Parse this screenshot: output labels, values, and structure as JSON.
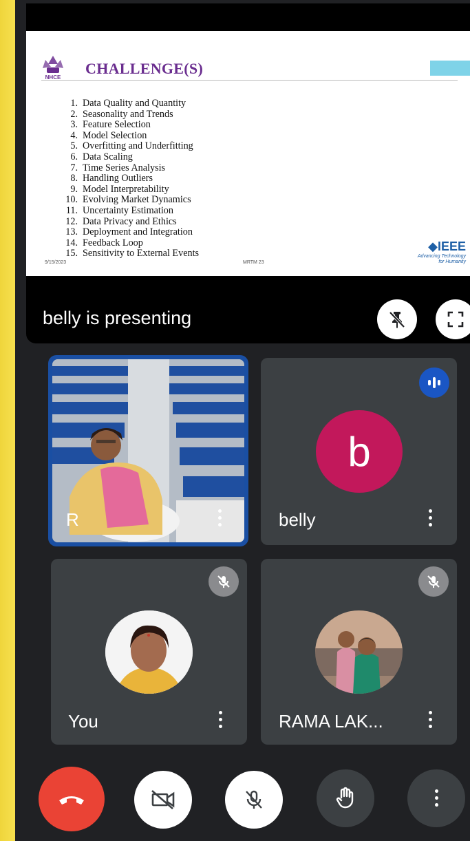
{
  "slide": {
    "title": "CHALLENGE(S)",
    "logo_text": "NHCE",
    "items": [
      {
        "num": "1.",
        "text": "Data Quality and Quantity"
      },
      {
        "num": "2.",
        "text": "Seasonality and Trends"
      },
      {
        "num": "3.",
        "text": "Feature Selection"
      },
      {
        "num": "4.",
        "text": "Model Selection"
      },
      {
        "num": "5.",
        "text": "Overfitting and Underfitting"
      },
      {
        "num": "6.",
        "text": "Data Scaling"
      },
      {
        "num": "7.",
        "text": "Time Series Analysis"
      },
      {
        "num": "8.",
        "text": "Handling Outliers"
      },
      {
        "num": "9.",
        "text": "Model Interpretability"
      },
      {
        "num": "10.",
        "text": "Evolving Market Dynamics"
      },
      {
        "num": "11.",
        "text": "Uncertainty Estimation"
      },
      {
        "num": "12.",
        "text": "Data Privacy and Ethics"
      },
      {
        "num": "13.",
        "text": "Deployment and Integration"
      },
      {
        "num": "14.",
        "text": "Feedback Loop"
      },
      {
        "num": "15.",
        "text": "Sensitivity to External Events"
      }
    ],
    "date": "9/15/2023",
    "footer_code": "MRTM 23",
    "ieee_brand": "IEEE",
    "ieee_tag_1": "Advancing Technology",
    "ieee_tag_2": "for Humanity"
  },
  "presentation": {
    "status_text": "belly is presenting",
    "unpin_icon": "unpin-icon",
    "fullscreen_icon": "fullscreen-icon"
  },
  "participants": [
    {
      "name": "R",
      "type": "video",
      "active_speaker": true
    },
    {
      "name": "belly",
      "type": "initial",
      "initial": "b",
      "avatar_color": "#c2185b",
      "speaking": true
    },
    {
      "name": "You",
      "type": "photo",
      "muted": true
    },
    {
      "name": "RAMA LAK...",
      "type": "photo",
      "muted": true
    }
  ],
  "controls": [
    {
      "name": "end-call",
      "icon": "hang-up-icon",
      "color": "#ea4335"
    },
    {
      "name": "camera-toggle",
      "icon": "camera-off-icon",
      "color": "#ffffff"
    },
    {
      "name": "mic-toggle",
      "icon": "mic-off-icon",
      "color": "#ffffff"
    },
    {
      "name": "raise-hand",
      "icon": "hand-icon",
      "color": "#3c4043"
    },
    {
      "name": "more-options",
      "icon": "more-vert-icon",
      "color": "#3c4043"
    }
  ],
  "colors": {
    "background": "#202124",
    "tile": "#3c4043",
    "active_border": "#1a4fa3",
    "speaking_badge": "#1a56c4",
    "accent_yellow": "#f7e04a"
  }
}
